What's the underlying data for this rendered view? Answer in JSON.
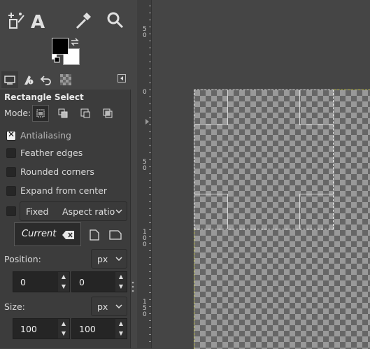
{
  "tool_options": {
    "title": "Rectangle Select",
    "mode_label": "Mode:",
    "antialiasing": {
      "label": "Antialiasing",
      "checked": true
    },
    "feather_edges": {
      "label": "Feather edges",
      "checked": false
    },
    "rounded_corners": {
      "label": "Rounded corners",
      "checked": false
    },
    "expand_from_center": {
      "label": "Expand from center",
      "checked": false
    },
    "fixed": {
      "label": "Fixed",
      "checked": false,
      "selected": "Aspect ratio"
    },
    "current": "Current",
    "position": {
      "label": "Position:",
      "unit": "px",
      "x": "0",
      "y": "0"
    },
    "size": {
      "label": "Size:",
      "unit": "px",
      "w": "100",
      "h": "100"
    }
  },
  "ruler": {
    "left_labels": [
      "5\n0",
      "0",
      "5\n0",
      "1\n0\n0",
      "1\n5\n0"
    ]
  },
  "colors": {
    "foreground": "#000000",
    "background": "#ffffff",
    "guide": "#c8c850"
  }
}
